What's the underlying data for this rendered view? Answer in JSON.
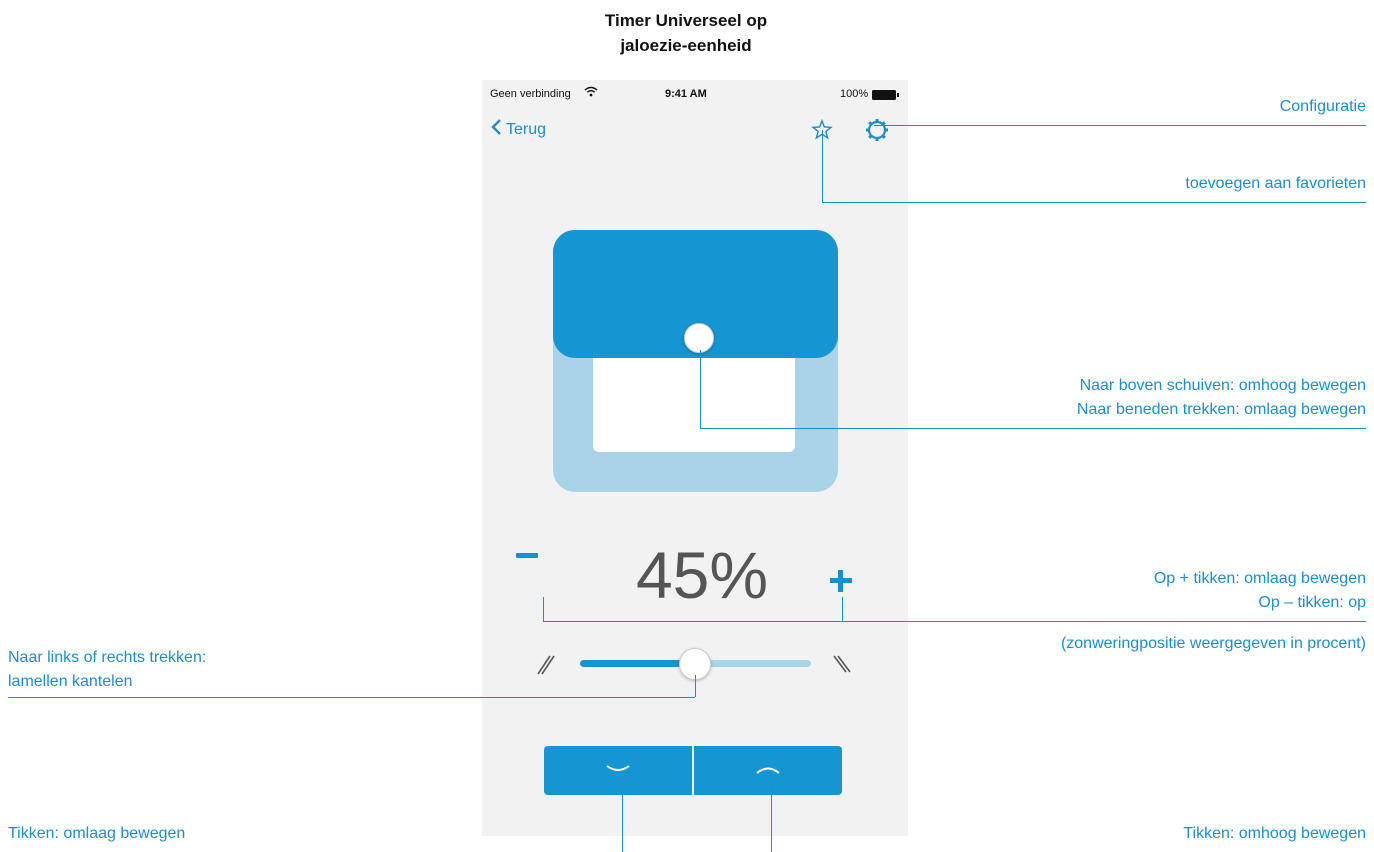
{
  "title": {
    "line1": "Timer Universeel op",
    "line2": "jaloezie-eenheid"
  },
  "status_bar": {
    "carrier": "Geen verbinding",
    "wifi_icon": "wifi-icon",
    "time": "9:41 AM",
    "battery": "100%",
    "battery_icon": "battery-icon"
  },
  "nav": {
    "back_label": "Terug",
    "back_icon": "chevron-left-icon",
    "favorite_icon": "star-icon",
    "config_icon": "gear-icon"
  },
  "blind": {
    "position_percent": 45,
    "position_label": "45%",
    "minus_icon": "minus-icon",
    "plus_icon": "plus-icon"
  },
  "tilt": {
    "slider_value": 0.5,
    "left_icon": "slats-closed-icon",
    "right_icon": "slats-open-icon"
  },
  "buttons": {
    "down_icon": "chevron-down-icon",
    "up_icon": "chevron-up-icon"
  },
  "annotations": {
    "config": "Configuratie",
    "favorites": "toevoegen aan favorieten",
    "slide_up": "Naar boven schuiven: omhoog bewegen",
    "drag_down": "Naar beneden trekken: omlaag bewegen",
    "plus_tap": "Op + tikken: omlaag bewegen",
    "minus_tap": "Op –  tikken: op",
    "percent_note": "(zonweringpositie weergegeven in procent)",
    "tilt_line1": "Naar links of rechts trekken:",
    "tilt_line2": "lamellen kantelen",
    "tap_down": "Tikken: omlaag bewegen",
    "tap_up": "Tikken: omhoog bewegen"
  },
  "colors": {
    "accent": "#1a8fd0",
    "shade": "#1695d3",
    "frame": "#a9d3e8"
  }
}
